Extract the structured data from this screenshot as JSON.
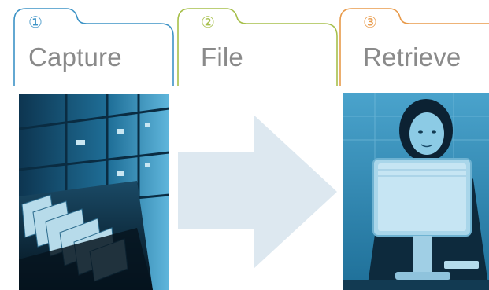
{
  "steps": [
    {
      "number": "①",
      "title": "Capture",
      "color": "#3d93c6"
    },
    {
      "number": "②",
      "title": "File",
      "color": "#a6bf4a"
    },
    {
      "number": "③",
      "title": "Retrieve",
      "color": "#e89a4a"
    }
  ],
  "images": {
    "left": "file-cabinet-photo",
    "right": "woman-at-computer-photo"
  },
  "arrow": {
    "color": "#dde8f0"
  }
}
